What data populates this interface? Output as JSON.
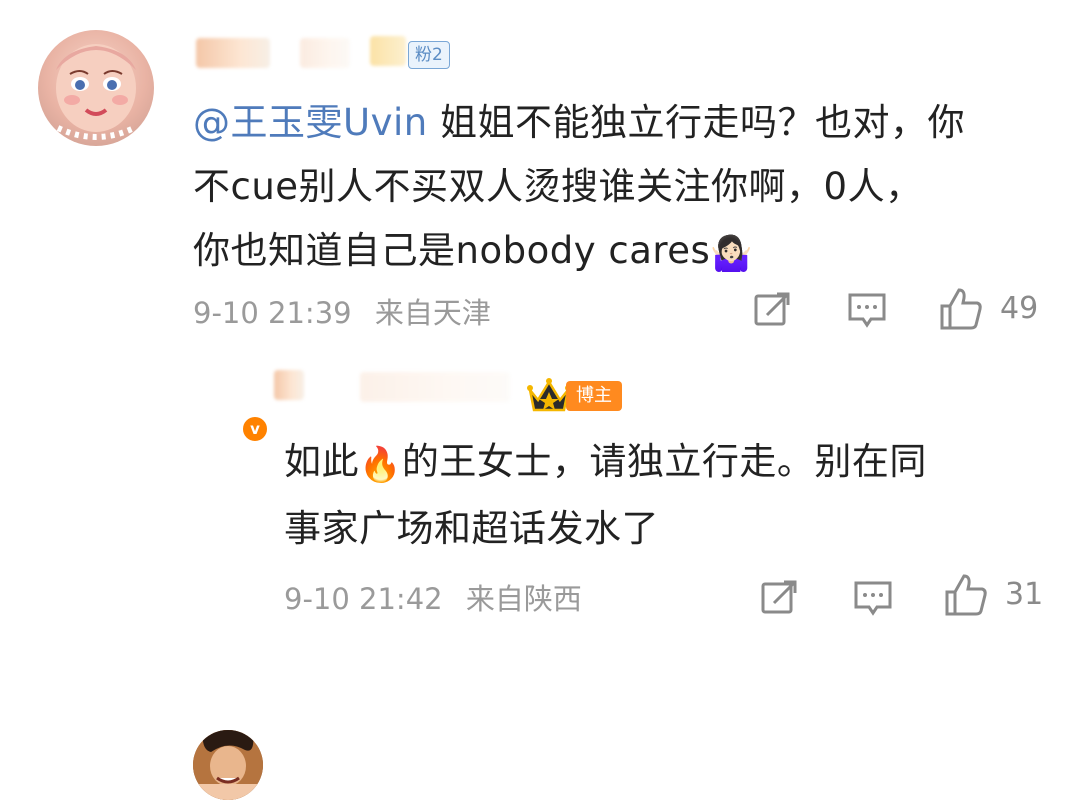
{
  "main_comment": {
    "fan_badge": "粉2",
    "mention": "@王玉雯Uvin",
    "line1": " 姐姐不能独立行走吗？也对，你",
    "line2": "不cue别人不买双人烫搜谁关注你啊，0人，",
    "line3": "你也知道自己是nobody cares",
    "emoji": "🤷🏻‍♀️",
    "date": "9-10 21:39",
    "location": "来自天津",
    "likes": "49"
  },
  "reply_comment": {
    "badge": "博主",
    "verify_mark": "v",
    "line1a": "如此",
    "emoji": "🔥",
    "line1b": "的王女士，请独立行走。别在同",
    "line2": "事家广场和超话发水了",
    "date": "9-10 21:42",
    "location": "来自陕西",
    "likes": "31"
  },
  "icons": {
    "share": "share-icon",
    "comment": "comment-icon",
    "like": "thumbs-up-icon"
  },
  "colors": {
    "mention": "#4f7bbb",
    "blogger_badge": "#ff8a1f",
    "verify": "#ff8200",
    "meta_text": "#9a9a9a"
  }
}
